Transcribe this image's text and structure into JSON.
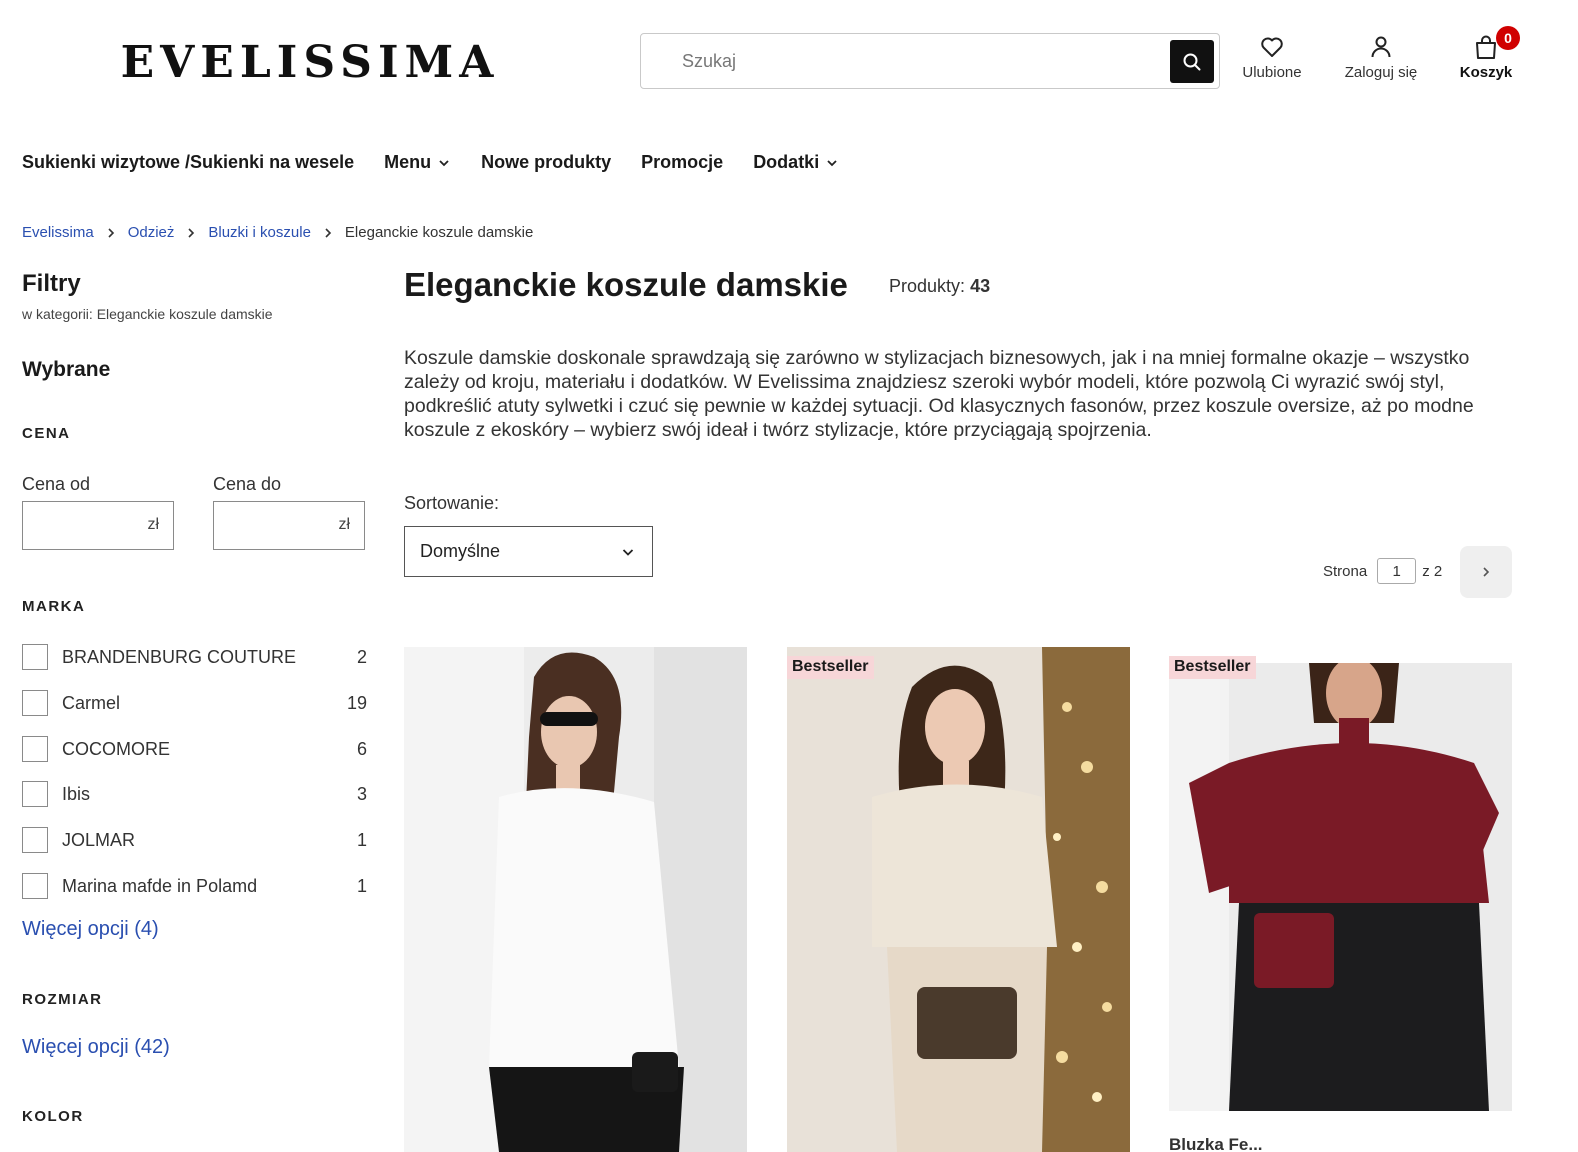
{
  "header": {
    "logo_text": "EVELISSIMA",
    "search_placeholder": "Szukaj",
    "favorites_label": "Ulubione",
    "login_label": "Zaloguj się",
    "cart_label": "Koszyk",
    "cart_count": "0"
  },
  "nav": {
    "items": [
      {
        "label": "Sukienki wizytowe /Sukienki na wesele",
        "has_dropdown": false
      },
      {
        "label": "Menu",
        "has_dropdown": true
      },
      {
        "label": "Nowe produkty",
        "has_dropdown": false
      },
      {
        "label": "Promocje",
        "has_dropdown": false
      },
      {
        "label": "Dodatki",
        "has_dropdown": true
      }
    ]
  },
  "breadcrumb": {
    "items": [
      "Evelissima",
      "Odzież",
      "Bluzki i koszule"
    ],
    "current": "Eleganckie koszule damskie"
  },
  "filters": {
    "title": "Filtry",
    "subtitle": "w kategorii: Eleganckie koszule damskie",
    "selected_title": "Wybrane",
    "price": {
      "heading": "CENA",
      "from_label": "Cena od",
      "to_label": "Cena do",
      "currency": "zł"
    },
    "brand": {
      "heading": "MARKA",
      "items": [
        {
          "name": "BRANDENBURG COUTURE",
          "count": "2"
        },
        {
          "name": "Carmel",
          "count": "19"
        },
        {
          "name": "COCOMORE",
          "count": "6"
        },
        {
          "name": "Ibis",
          "count": "3"
        },
        {
          "name": "JOLMAR",
          "count": "1"
        },
        {
          "name": "Marina mafde in Polamd",
          "count": "1"
        }
      ],
      "more_label": "Więcej opcji (4)"
    },
    "size": {
      "heading": "ROZMIAR",
      "more_label": "Więcej opcji (42)"
    },
    "color": {
      "heading": "KOLOR"
    }
  },
  "main": {
    "title": "Eleganckie koszule damskie",
    "products_label": "Produkty:",
    "products_count": "43",
    "description": "Koszule damskie doskonale sprawdzają się zarówno w stylizacjach biznesowych, jak i na mniej formalne okazje – wszystko zależy od kroju, materiału i dodatków. W Evelissima znajdziesz szeroki wybór modeli, które pozwolą Ci wyrazić swój styl, podkreślić atuty sylwetki i czuć się pewnie w każdej sytuacji. Od klasycznych fasonów, przez koszule oversize, aż po modne koszule z ekoskóry – wybierz swój ideał i twórz stylizacje, które przyciągają spojrzenia.",
    "sort_label": "Sortowanie:",
    "sort_value": "Domyślne",
    "pager": {
      "page_label": "Strona",
      "current_page": "1",
      "of_label": "z 2"
    }
  },
  "products": [
    {
      "badge": "",
      "colors": {
        "bg": "#ececec",
        "top": "#fafafa",
        "bottom": "#151515",
        "hair": "#4a2f22"
      }
    },
    {
      "badge": "Bestseller",
      "colors": {
        "bg": "#e8e1d8",
        "top": "#ede5d8",
        "bottom": "#e6d9c8",
        "hair": "#3d2719"
      }
    },
    {
      "badge": "Bestseller",
      "colors": {
        "bg": "#ebebeb",
        "top": "#7a1a26",
        "bottom": "#1c1c1e",
        "hair": "#3b2418"
      }
    }
  ],
  "product_peek_text": "Bluzka Fe..."
}
